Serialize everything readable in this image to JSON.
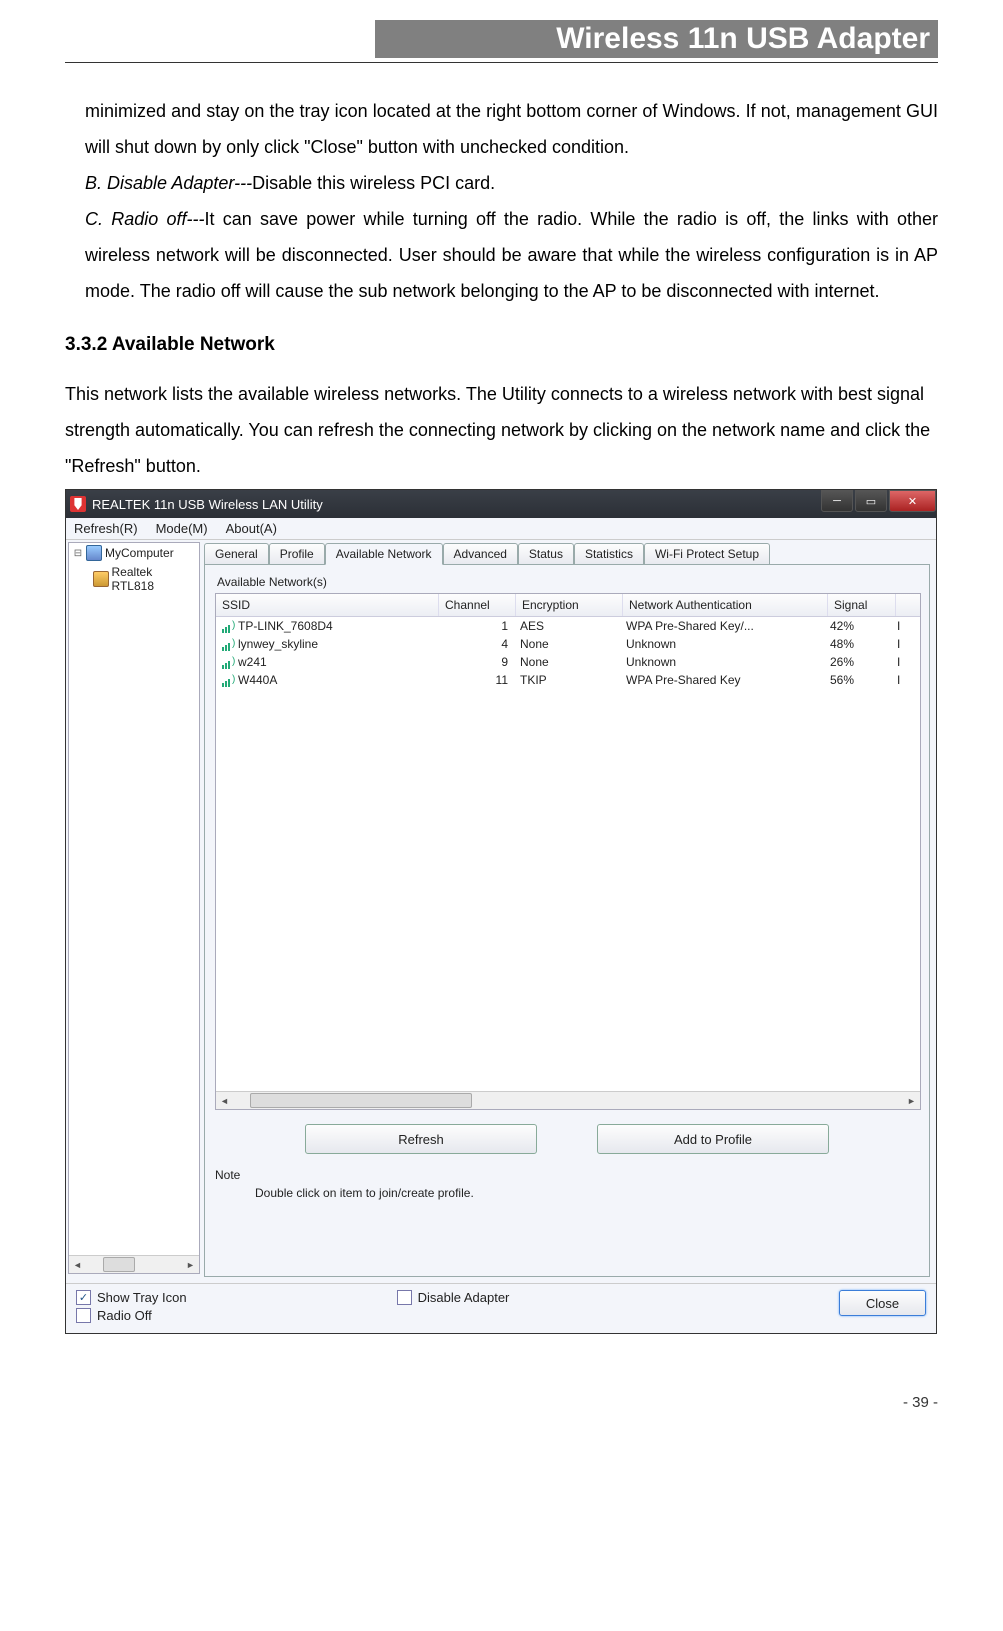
{
  "header": {
    "title": "Wireless 11n USB Adapter"
  },
  "doc": {
    "para_a": "minimized and stay on the tray icon located at the right bottom corner of Windows. If not, management GUI will shut down by only click \"Close\" button with unchecked condition.",
    "para_b_head": "B. Disable Adapter---",
    "para_b_body": "Disable this wireless PCI card.",
    "para_c_head": "C. Radio off---",
    "para_c_body": "It can save power while turning off the radio. While the radio is off, the links with other wireless network will be disconnected. User should be aware that while the wireless configuration is in AP mode. The radio off will cause the sub network belonging to the AP to be disconnected with internet.",
    "section_heading": "3.3.2    Available Network",
    "intro": "This network lists the available wireless networks. The Utility connects to a wireless network with best signal strength automatically. You can refresh the connecting network by clicking on the network name and click the \"Refresh\" button."
  },
  "app": {
    "title": "REALTEK 11n USB Wireless LAN Utility",
    "menu": {
      "refresh": "Refresh(R)",
      "mode": "Mode(M)",
      "about": "About(A)"
    },
    "tree": {
      "root": "MyComputer",
      "child": "Realtek RTL818"
    },
    "tabs": {
      "general": "General",
      "profile": "Profile",
      "available": "Available Network",
      "advanced": "Advanced",
      "status": "Status",
      "statistics": "Statistics",
      "wps": "Wi-Fi Protect Setup"
    },
    "group_label": "Available Network(s)",
    "columns": {
      "ssid": "SSID",
      "channel": "Channel",
      "encryption": "Encryption",
      "auth": "Network Authentication",
      "signal": "Signal"
    },
    "rows": [
      {
        "ssid": "TP-LINK_7608D4",
        "channel": "1",
        "encryption": "AES",
        "auth": "WPA Pre-Shared Key/...",
        "signal": "42%",
        "extra": "I"
      },
      {
        "ssid": "lynwey_skyline",
        "channel": "4",
        "encryption": "None",
        "auth": "Unknown",
        "signal": "48%",
        "extra": "I"
      },
      {
        "ssid": "w241",
        "channel": "9",
        "encryption": "None",
        "auth": "Unknown",
        "signal": "26%",
        "extra": "I"
      },
      {
        "ssid": "W440A",
        "channel": "11",
        "encryption": "TKIP",
        "auth": "WPA Pre-Shared Key",
        "signal": "56%",
        "extra": "I"
      }
    ],
    "buttons": {
      "refresh": "Refresh",
      "add_profile": "Add to Profile"
    },
    "note": {
      "label": "Note",
      "text": "Double click on item to join/create profile."
    },
    "bottom": {
      "show_tray": "Show Tray Icon",
      "radio_off": "Radio Off",
      "disable_adapter": "Disable Adapter",
      "close": "Close"
    }
  },
  "page_number": "- 39 -"
}
